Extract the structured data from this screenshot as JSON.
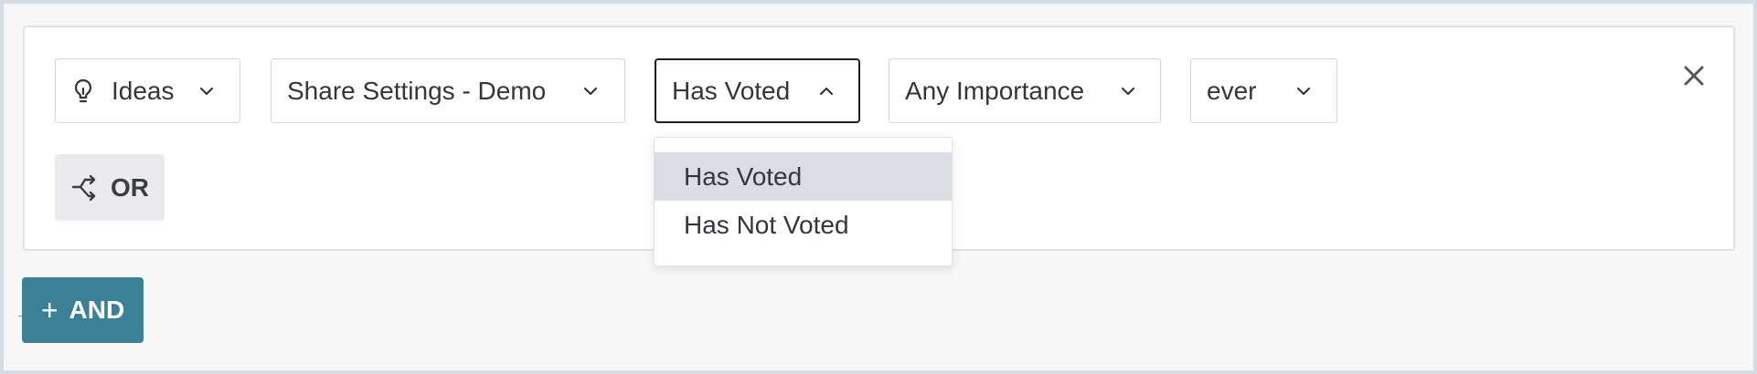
{
  "filters": {
    "type": {
      "label": "Ideas",
      "icon": "lightbulb-icon"
    },
    "portal": {
      "label": "Share Settings - Demo"
    },
    "vote_status": {
      "label": "Has Voted",
      "expanded": true
    },
    "importance": {
      "label": "Any Importance"
    },
    "time": {
      "label": "ever"
    }
  },
  "dropdown": {
    "options": [
      {
        "label": "Has Voted",
        "selected": true
      },
      {
        "label": "Has Not Voted",
        "selected": false
      }
    ]
  },
  "actions": {
    "or_label": "OR",
    "and_label": "AND",
    "and_prefix": "+"
  },
  "colors": {
    "and_button": "#3b8196",
    "or_button": "#eaebee",
    "selected_option": "#dadde3",
    "active_border": "#1d1f22"
  }
}
